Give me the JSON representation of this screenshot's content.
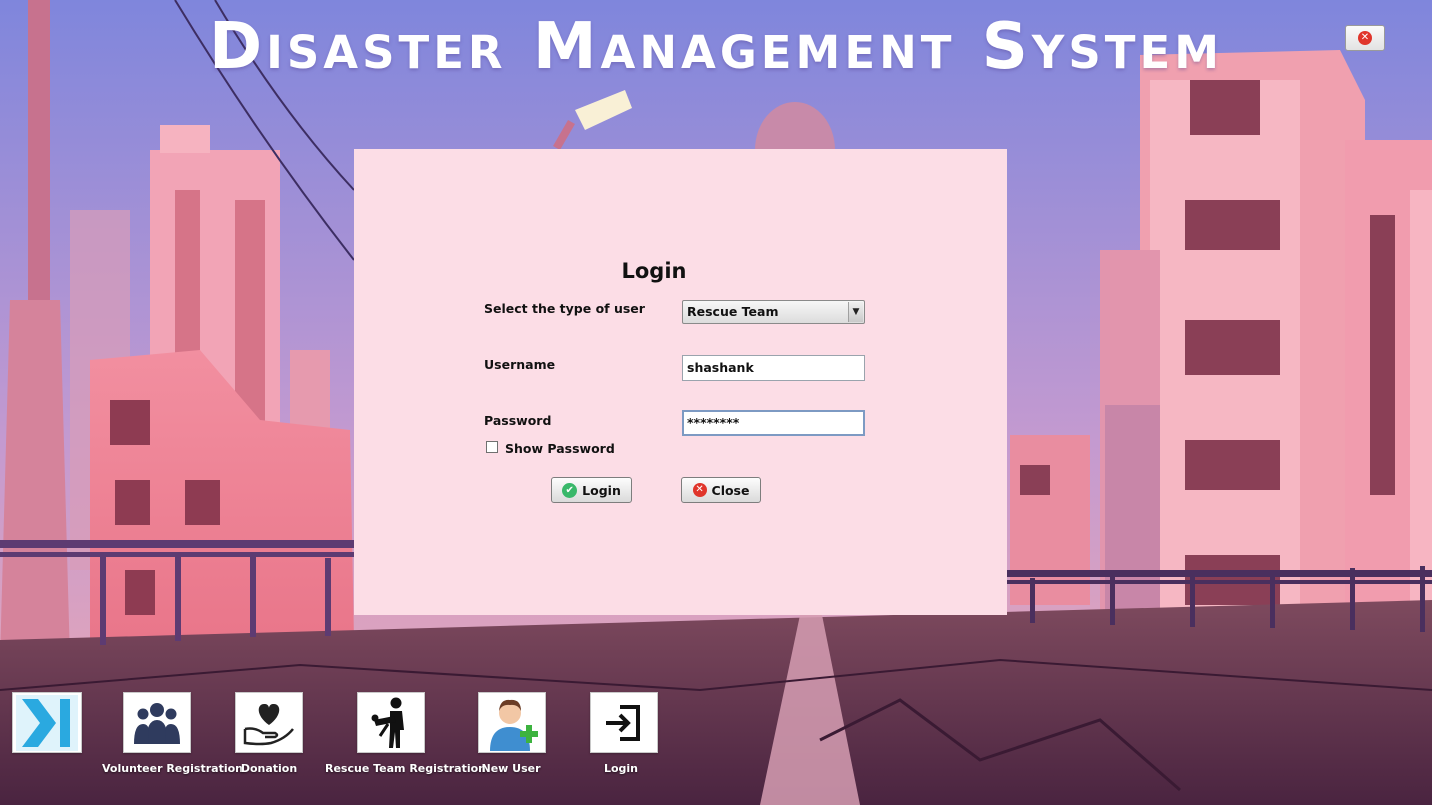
{
  "app": {
    "title": "Disaster Management System"
  },
  "window": {
    "close_icon": "close-icon"
  },
  "login_form": {
    "heading": "Login",
    "user_type_label": "Select the type of user",
    "user_type_value": "Rescue Team",
    "username_label": "Username",
    "username_value": "shashank",
    "password_label": "Password",
    "password_value": "********",
    "show_password_label": "Show Password",
    "show_password_checked": false,
    "login_button": "Login",
    "close_button": "Close"
  },
  "dock": {
    "items": [
      {
        "label": "",
        "icon": "skip-forward-icon"
      },
      {
        "label": "Volunteer Registration",
        "icon": "group-icon"
      },
      {
        "label": "Donation",
        "icon": "heart-in-hand-icon"
      },
      {
        "label": "Rescue Team Registration",
        "icon": "rescuer-icon"
      },
      {
        "label": "New User",
        "icon": "add-user-icon"
      },
      {
        "label": "Login",
        "icon": "login-icon"
      }
    ]
  },
  "colors": {
    "panel_bg": "#fcdde6",
    "sky_top": "#7f86dc",
    "sky_bottom": "#e8a7b8",
    "road": "#5a3046",
    "building_pink": "#e97f95",
    "accent_blue": "#2aa9e0",
    "close_red": "#e0352b",
    "login_green": "#39b86a"
  }
}
